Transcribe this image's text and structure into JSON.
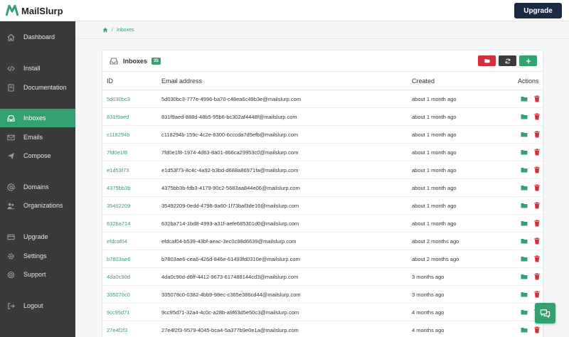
{
  "brand": {
    "name": "MailSlurp",
    "accent": "#34a270"
  },
  "header": {
    "upgrade_label": "Upgrade"
  },
  "sidebar": {
    "items": [
      {
        "label": "Dashboard",
        "icon": "home-icon"
      },
      {
        "label": "Install",
        "icon": "code-icon"
      },
      {
        "label": "Documentation",
        "icon": "book-icon"
      },
      {
        "label": "Inboxes",
        "icon": "inbox-icon",
        "active": true
      },
      {
        "label": "Emails",
        "icon": "envelope-icon"
      },
      {
        "label": "Compose",
        "icon": "send-icon"
      },
      {
        "label": "Domains",
        "icon": "at-icon"
      },
      {
        "label": "Organizations",
        "icon": "users-icon"
      },
      {
        "label": "Upgrade",
        "icon": "card-icon"
      },
      {
        "label": "Settings",
        "icon": "gear-icon"
      },
      {
        "label": "Support",
        "icon": "lifebuoy-icon"
      },
      {
        "label": "Logout",
        "icon": "logout-icon"
      }
    ]
  },
  "breadcrumb": {
    "current": "Inboxes"
  },
  "inboxes": {
    "title": "Inboxes",
    "count": "35",
    "columns": [
      "ID",
      "Email address",
      "Created",
      "Actions"
    ],
    "rows": [
      {
        "id": "5d030bc3",
        "email": "5d030bc3-777e-4996-ba70-c48ea6c49b3e@mailslurp.com",
        "created": "about 1 month ago"
      },
      {
        "id": "831f9aed",
        "email": "831f9aed-888d-48b5-95b6-bc302af4448f@mailslurp.com",
        "created": "about 1 month ago"
      },
      {
        "id": "c118294b",
        "email": "c118294b-159c-4c2e-8300-6cccda7d5efb@mailslurp.com",
        "created": "about 1 month ago"
      },
      {
        "id": "7fd0e1f8",
        "email": "7fd0e1f8-1974-4d63-8a01-866ca29953c0@mailslurp.com",
        "created": "about 1 month ago"
      },
      {
        "id": "e1d53f73",
        "email": "e1d53f73-8c4c-4a92-b3bd-d688a86971fa@mailslurp.com",
        "created": "about 1 month ago"
      },
      {
        "id": "4375bb3b",
        "email": "4375bb3b-fdb3-4179-90c2-5683aa844e06@mailslurp.com",
        "created": "about 1 month ago"
      },
      {
        "id": "35492209",
        "email": "35492209-0edd-4798-9a60-1f73baf3de16@mailslurp.com",
        "created": "about 1 month ago"
      },
      {
        "id": "632ba714",
        "email": "632ba714-1bd8-4993-a31f-aefe685301d0@mailslurp.com",
        "created": "about 1 month ago"
      },
      {
        "id": "efdcaf04",
        "email": "efdcaf04-b539-43bf-aeac-3ec0c98d6639@mailslurp.com",
        "created": "about 2 months ago"
      },
      {
        "id": "b7803ae6",
        "email": "b7803ae6-cea6-426d-846e-61493fd0310e@mailslurp.com",
        "created": "about 2 months ago"
      },
      {
        "id": "4da0c90d",
        "email": "4da0c90d-d6ff-4412-9673-617488144cd3@mailslurp.com",
        "created": "3 months ago"
      },
      {
        "id": "335078c0",
        "email": "335078c0-0382-4bb9-98ec-c365e386cd44@mailslurp.com",
        "created": "3 months ago"
      },
      {
        "id": "9cc95d71",
        "email": "9cc95d71-32a4-4c0c-a28b-a9f63d5e50c3@mailslurp.com",
        "created": "4 months ago"
      },
      {
        "id": "27e4f2f3",
        "email": "27e4f2f3-9579-4045-bca4-5a377b9e0e1a@mailslurp.com",
        "created": "4 months ago"
      }
    ]
  }
}
